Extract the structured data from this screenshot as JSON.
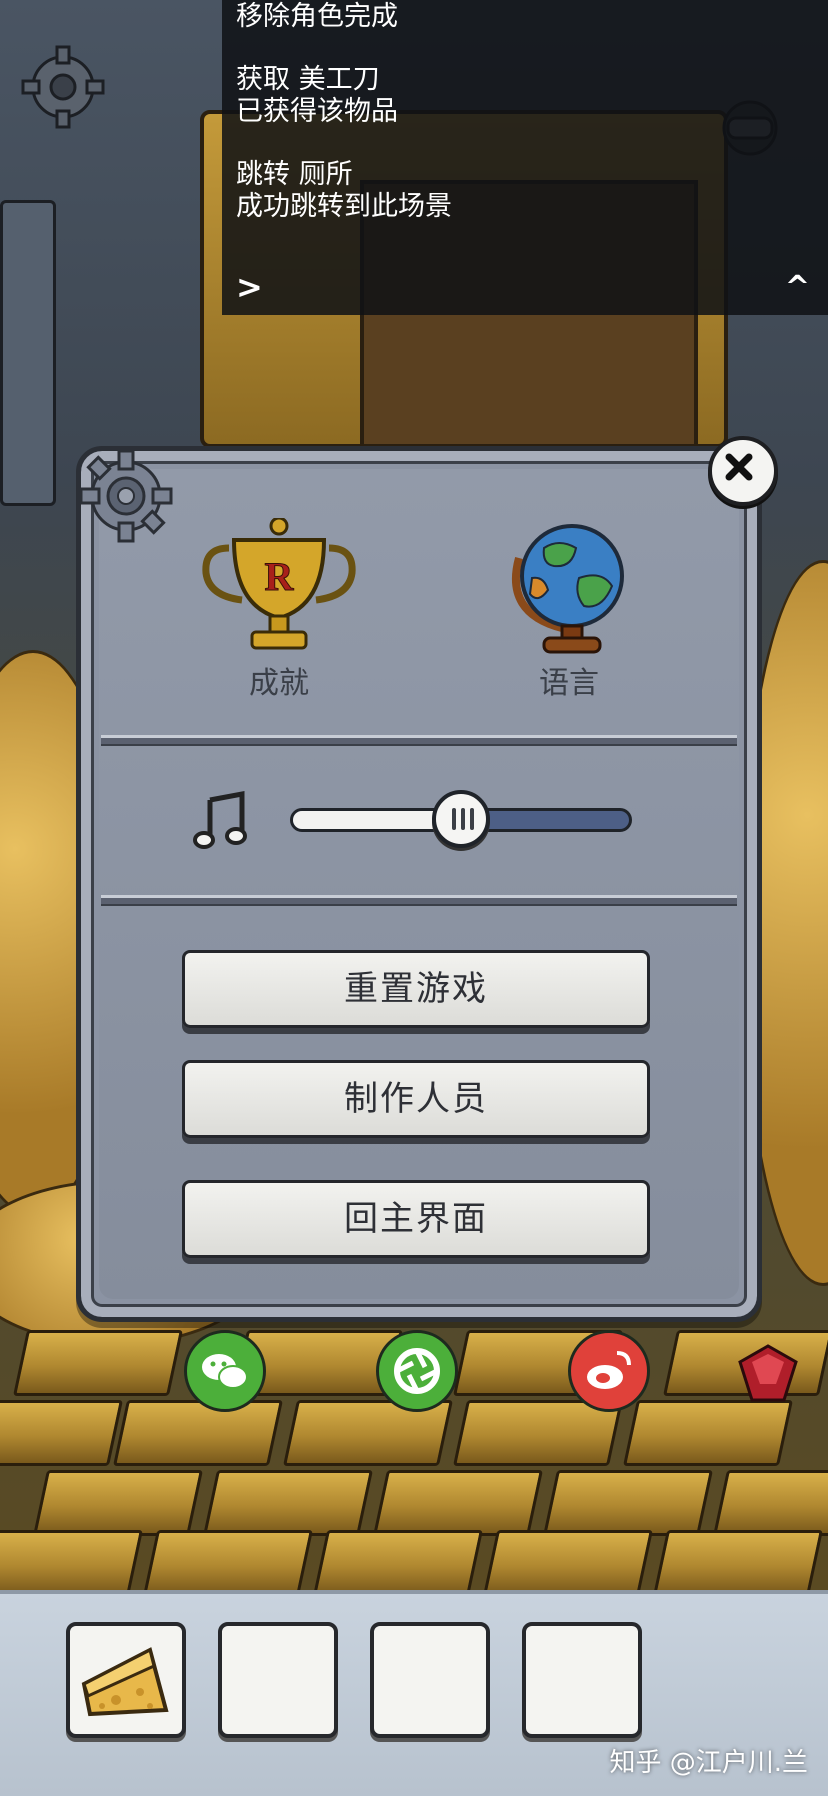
{
  "log": {
    "lines": [
      "移除角色完成",
      "获取 美工刀",
      "已获得该物品",
      "跳转 厕所",
      "成功跳转到此场景"
    ],
    "next_label": ">",
    "collapse_label": "^"
  },
  "settings": {
    "achievements_label": "成就",
    "language_label": "语言",
    "volume_level": 0.5,
    "buttons": {
      "reset": "重置游戏",
      "credits": "制作人员",
      "main_menu": "回主界面"
    }
  },
  "share": [
    {
      "icon": "wechat-icon",
      "color": "#4caf3a"
    },
    {
      "icon": "moments-icon",
      "color": "#4caf3a"
    },
    {
      "icon": "weibo-icon",
      "color": "#e0413a"
    }
  ],
  "inventory": {
    "slots": [
      {
        "item": "cheese-icon"
      },
      {
        "item": ""
      },
      {
        "item": ""
      },
      {
        "item": ""
      }
    ]
  },
  "watermark": "知乎 @江户川.兰"
}
